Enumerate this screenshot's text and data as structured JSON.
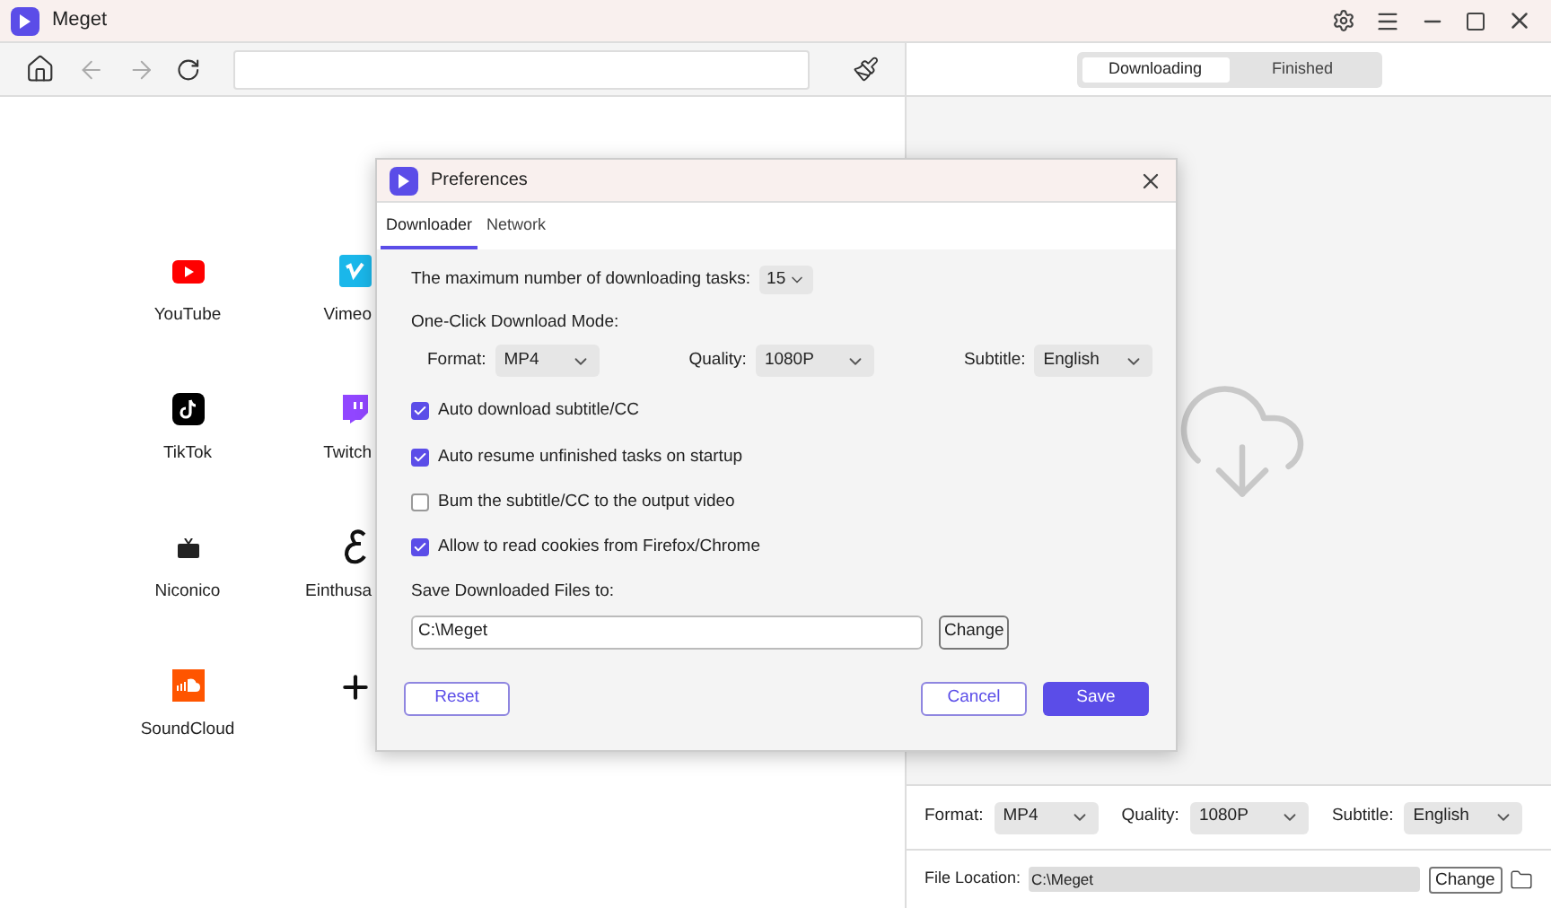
{
  "app": {
    "title": "Meget"
  },
  "sites": [
    {
      "name": "YouTube",
      "kind": "youtube"
    },
    {
      "name": "Vimeo",
      "kind": "vimeo"
    },
    {
      "name": "TikTok",
      "kind": "tiktok"
    },
    {
      "name": "Twitch",
      "kind": "twitch"
    },
    {
      "name": "Niconico",
      "kind": "niconico"
    },
    {
      "name": "Einthusa",
      "kind": "einthusan"
    },
    {
      "name": "SoundCloud",
      "kind": "soundcloud"
    },
    {
      "kind": "add"
    }
  ],
  "download_tabs": [
    {
      "label": "Downloading",
      "selected": true
    },
    {
      "label": "Finished",
      "selected": false
    }
  ],
  "bottom": {
    "selects": [
      {
        "label": "Format:",
        "value": "MP4"
      },
      {
        "label": "Quality:",
        "value": "1080P"
      },
      {
        "label": "Subtitle:",
        "value": "English"
      }
    ],
    "file_location": {
      "label": "File Location:",
      "value": "C:\\Meget"
    },
    "change_button": "Change"
  },
  "dialog": {
    "title": "Preferences",
    "tabs": [
      {
        "label": "Downloader",
        "selected": true
      },
      {
        "label": "Network",
        "selected": false
      }
    ],
    "max_tasks": {
      "label": "The maximum number of downloading tasks:",
      "value": "15"
    },
    "mode_label": "One-Click Download Mode:",
    "selects": [
      {
        "label": "Format:",
        "value": "MP4"
      },
      {
        "label": "Quality:",
        "value": "1080P"
      },
      {
        "label": "Subtitle:",
        "value": "English"
      }
    ],
    "options": [
      {
        "label": "Auto download subtitle/CC",
        "checked": true
      },
      {
        "label": "Auto resume unfinished tasks on startup",
        "checked": true
      },
      {
        "label": "Bum the subtitle/CC to the output video",
        "checked": false
      },
      {
        "label": "Allow to read cookies from Firefox/Chrome",
        "checked": true
      }
    ],
    "save_label": "Save Downloaded Files to:",
    "save_path": "C:\\Meget",
    "change_button": "Change",
    "buttons": {
      "reset": "Reset",
      "cancel": "Cancel",
      "save": "Save"
    }
  }
}
